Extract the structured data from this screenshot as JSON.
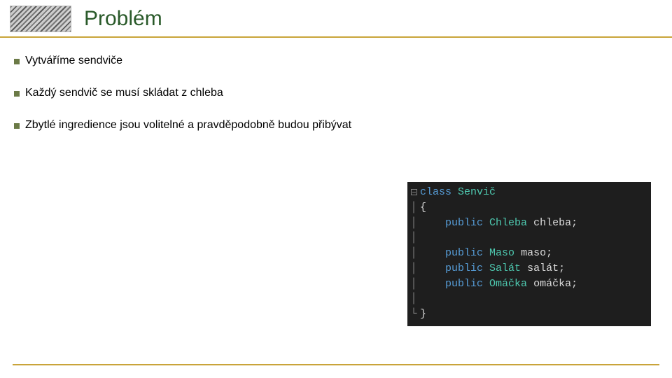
{
  "title": "Problém",
  "bullets": [
    "Vytváříme sendviče",
    "Každý sendvič se musí skládat z chleba",
    "Zbytlé ingredience jsou volitelné a pravděpodobně budou přibývat"
  ],
  "code": {
    "class_keyword": "class",
    "class_name": "Senvič",
    "open_brace": "{",
    "close_brace": "}",
    "lines": [
      {
        "modifier": "public",
        "type": "Chleba",
        "name": "chleba",
        "semi": ";"
      },
      {
        "modifier": "public",
        "type": "Maso",
        "name": "maso",
        "semi": ";"
      },
      {
        "modifier": "public",
        "type": "Salát",
        "name": "salát",
        "semi": ";"
      },
      {
        "modifier": "public",
        "type": "Omáčka",
        "name": "omáčka",
        "semi": ";"
      }
    ]
  }
}
